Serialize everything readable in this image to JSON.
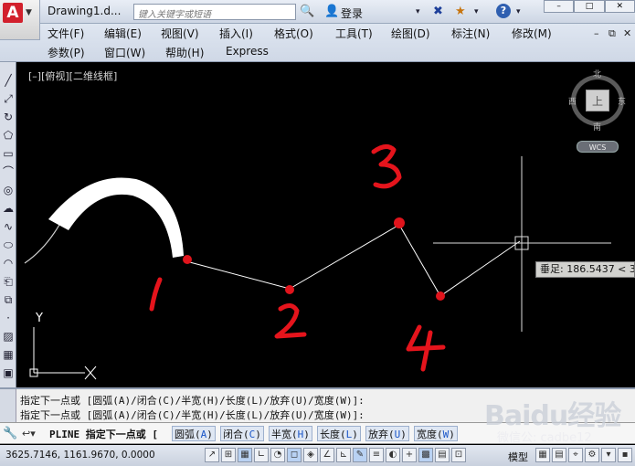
{
  "title_bar": {
    "app_logo": "A",
    "doc_title": "Drawing1.d...",
    "search_placeholder": "键入关键字或短语",
    "login_label": "登录",
    "icons": [
      "binoculars-icon",
      "user-icon",
      "exchange-icon",
      "star-icon",
      "help-icon"
    ],
    "help_glyph": "?",
    "window_controls": [
      "–",
      "□",
      "✕"
    ]
  },
  "menu": {
    "row1": [
      "文件(F)",
      "编辑(E)",
      "视图(V)",
      "插入(I)",
      "格式(O)",
      "工具(T)",
      "绘图(D)",
      "标注(N)",
      "修改(M)"
    ],
    "row2": [
      "参数(P)",
      "窗口(W)",
      "帮助(H)",
      "Express"
    ],
    "mdi_controls": [
      "–",
      "⧉",
      "✕"
    ]
  },
  "viewport": {
    "label": "[–][俯视][二维线框]"
  },
  "viewcube": {
    "north": "北",
    "south": "南",
    "east": "东",
    "west": "西",
    "face": "上",
    "wcs": "WCS"
  },
  "dynamic_input": {
    "text": "垂足: 186.5437 < 3"
  },
  "drawing": {
    "annotations": [
      "1",
      "2",
      "3",
      "4"
    ],
    "ucs_labels": {
      "y": "Y",
      "x": "X"
    },
    "line_color": "#ffffff",
    "marker_color": "#e0141c",
    "annotation_color": "#e5141c"
  },
  "command": {
    "history": [
      "指定下一点或 [圆弧(A)/闭合(C)/半宽(H)/长度(L)/放弃(U)/宽度(W)]:",
      "指定下一点或 [圆弧(A)/闭合(C)/半宽(H)/长度(L)/放弃(U)/宽度(W)]:"
    ],
    "prefix": "PLINE 指定下一点或 [",
    "options": [
      {
        "label": "圆弧(",
        "key": "A",
        "end": ")"
      },
      {
        "label": "闭合(",
        "key": "C",
        "end": ")"
      },
      {
        "label": "半宽(",
        "key": "H",
        "end": ")"
      },
      {
        "label": "长度(",
        "key": "L",
        "end": ")"
      },
      {
        "label": "放弃(",
        "key": "U",
        "end": ")"
      },
      {
        "label": "宽度(",
        "key": "W",
        "end": ")"
      }
    ]
  },
  "status": {
    "coords": "3625.7146, 1161.9670, 0.0000",
    "model_label": "模型"
  },
  "watermark": {
    "main": "Baidu经验",
    "sub": "微信公: cadbe12"
  }
}
